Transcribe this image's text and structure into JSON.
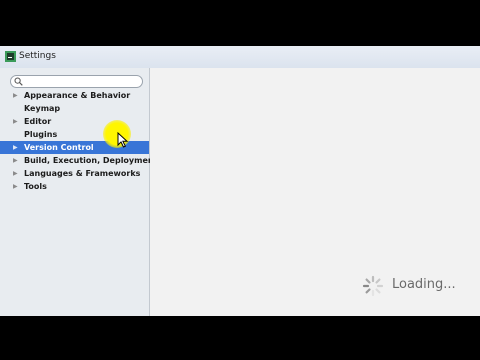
{
  "window": {
    "title": "Settings",
    "icon": "intellij-app-icon"
  },
  "search": {
    "placeholder": "",
    "value": ""
  },
  "tree": [
    {
      "label": "Appearance & Behavior",
      "expandable": true,
      "selected": false
    },
    {
      "label": "Keymap",
      "expandable": false,
      "selected": false
    },
    {
      "label": "Editor",
      "expandable": true,
      "selected": false
    },
    {
      "label": "Plugins",
      "expandable": false,
      "selected": false
    },
    {
      "label": "Version Control",
      "expandable": true,
      "selected": true
    },
    {
      "label": "Build, Execution, Deployment",
      "expandable": true,
      "selected": false
    },
    {
      "label": "Languages & Frameworks",
      "expandable": true,
      "selected": false
    },
    {
      "label": "Tools",
      "expandable": true,
      "selected": false
    }
  ],
  "content": {
    "loading_text": "Loading..."
  },
  "colors": {
    "selection": "#3875d7",
    "cursor_highlight": "#fff600"
  }
}
